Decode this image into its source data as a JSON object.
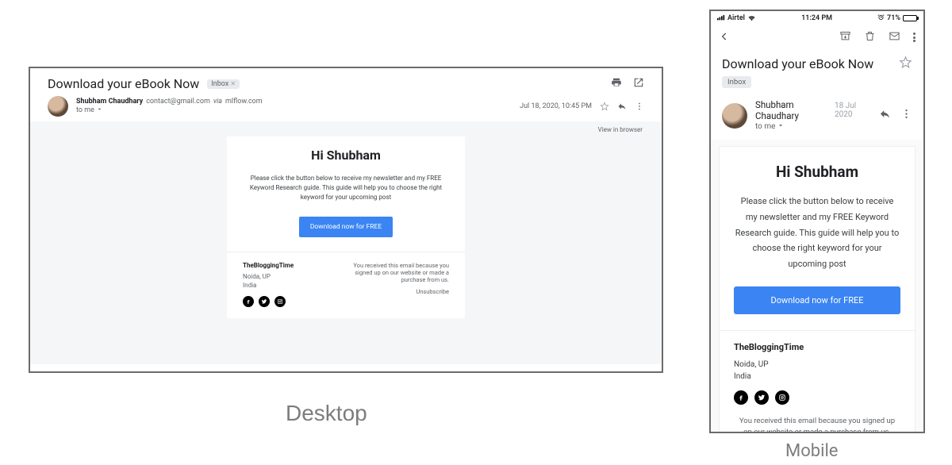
{
  "labels": {
    "desktop": "Desktop",
    "mobile": "Mobile"
  },
  "subject": "Download your eBook Now",
  "inbox_chip": "Inbox",
  "desktop": {
    "sender_name": "Shubham Chaudhary",
    "sender_addr": "contact@gmail.com",
    "via_word": "via",
    "via_domain": "mlflow.com",
    "to_line": "to me",
    "timestamp": "Jul 18, 2020, 10:45 PM",
    "view_in_browser": "View in browser"
  },
  "mobile": {
    "carrier": "Airtel",
    "clock": "11:24 PM",
    "battery_pct": "71%",
    "sender_name": "Shubham Chaudhary",
    "date": "18 Jul 2020",
    "to_line": "to me"
  },
  "email": {
    "greeting": "Hi Shubham",
    "body": "Please click the button below to receive my newsletter and my FREE Keyword Research guide. This guide will help you to choose the right keyword for your upcoming post",
    "cta": "Download now for FREE",
    "brand": "TheBloggingTime",
    "loc1": "Noida, UP",
    "loc2": "India",
    "reason": "You received this email because you signed up on our website or made a purchase from us.",
    "unsubscribe": "Unsubscribe"
  }
}
